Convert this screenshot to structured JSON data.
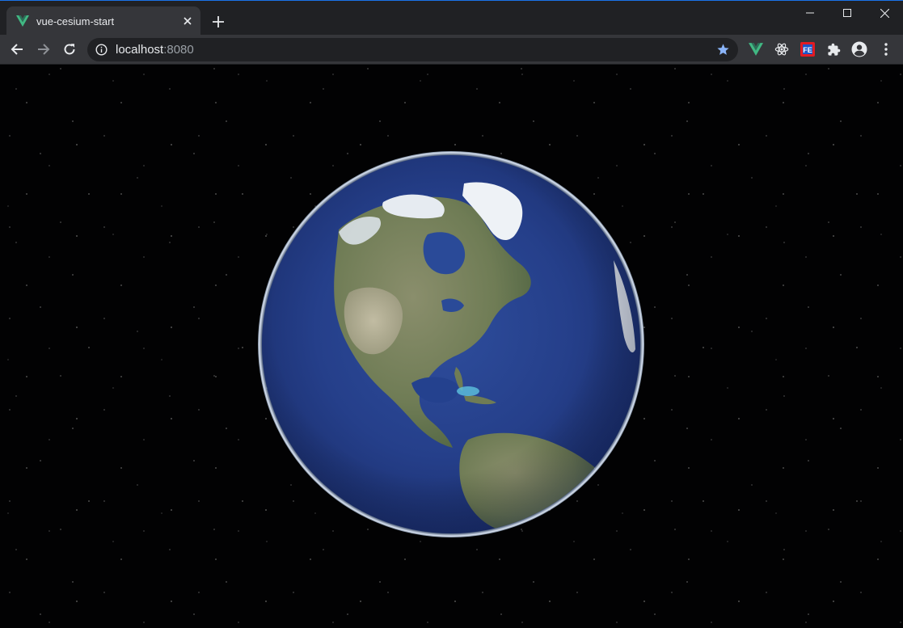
{
  "tab": {
    "title": "vue-cesium-start",
    "favicon": "vue-logo-icon"
  },
  "window_controls": [
    "minimize-icon",
    "maximize-icon",
    "close-icon"
  ],
  "toolbar": {
    "url_host": "localhost",
    "url_port": ":8080"
  },
  "extensions": [
    "vue-devtools-icon",
    "react-devtools-icon",
    "fe-helper-icon",
    "extensions-puzzle-icon",
    "profile-icon",
    "menu-icon"
  ],
  "colors": {
    "vue_green": "#41b883",
    "accent_blue": "#1a73e8",
    "star_blue": "#8ab4f8"
  }
}
